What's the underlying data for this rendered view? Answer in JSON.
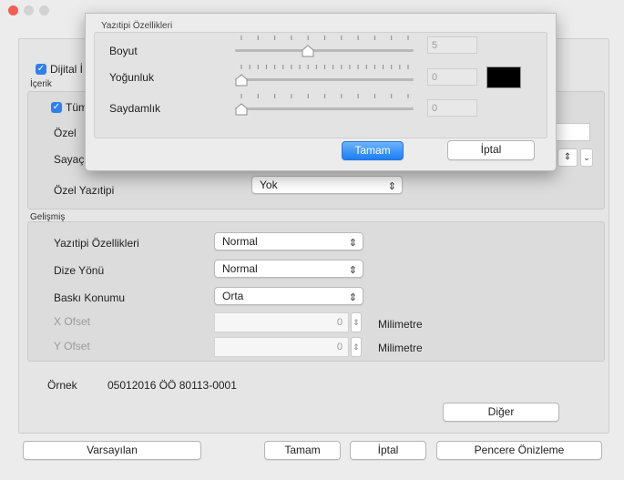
{
  "window": {
    "traffic_lights": [
      "#f45d54",
      "#d2d2d2",
      "#d2d2d2"
    ]
  },
  "background": {
    "dijital_checkbox_label": "Dijital İ",
    "content_group_title": "İçerik",
    "all_checkbox_label": "Tüm",
    "custom_label": "Özel",
    "counter_label": "Sayaç",
    "custom_font_label": "Özel Yazıtipi",
    "custom_font_value": "Yok",
    "advanced_group_title": "Gelişmiş",
    "font_props_label": "Yazıtipi Özellikleri",
    "font_props_value": "Normal",
    "string_dir_label": "Dize Yönü",
    "string_dir_value": "Normal",
    "print_pos_label": "Baskı Konumu",
    "print_pos_value": "Orta",
    "x_offset_label": "X Ofset",
    "x_offset_value": "0",
    "y_offset_label": "Y Ofset",
    "y_offset_value": "0",
    "unit_label": "Milimetre",
    "sample_label": "Örnek",
    "sample_value": "05012016 ÖÖ 80113-0001",
    "other_button": "Diğer",
    "defaults_button": "Varsayılan",
    "ok_button": "Tamam",
    "cancel_button": "İptal",
    "preview_button": "Pencere Önizleme"
  },
  "dialog": {
    "title": "Yazıtipi Özellikleri",
    "size_label": "Boyut",
    "size_value": "5",
    "size_level": 0.4,
    "density_label": "Yoğunluk",
    "density_value": "0",
    "density_level": 0,
    "color_swatch": "#000000",
    "transparency_label": "Saydamlık",
    "transparency_value": "0",
    "transparency_level": 0,
    "ok_button": "Tamam",
    "cancel_button": "İptal"
  },
  "colors": {
    "accent": "#1d7ef5",
    "checkbox": "#2f80ed"
  }
}
